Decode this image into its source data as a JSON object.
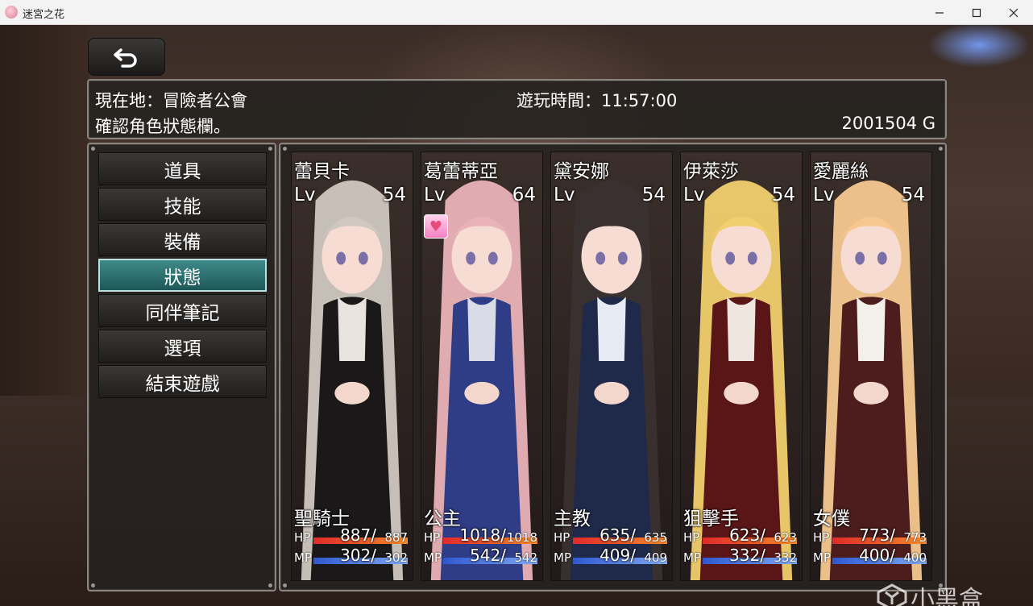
{
  "window": {
    "title": "迷宮之花",
    "minimize_icon": "minimize-icon",
    "maximize_icon": "maximize-icon",
    "close_icon": "close-icon"
  },
  "back_button": {
    "icon": "return-arrow-icon"
  },
  "info": {
    "location": "現在地：冒險者公會",
    "playtime": "遊玩時間：11:57:00",
    "hint": "確認角色狀態欄。",
    "gold": "2001504 G"
  },
  "menu": {
    "items": [
      {
        "label": "道具"
      },
      {
        "label": "技能"
      },
      {
        "label": "裝備"
      },
      {
        "label": "狀態",
        "active": true
      },
      {
        "label": "同伴筆記"
      },
      {
        "label": "選項"
      },
      {
        "label": "結束遊戲"
      }
    ]
  },
  "party": [
    {
      "name": "蕾貝卡",
      "lv_label": "Lv",
      "lv": "54",
      "class": "聖騎士",
      "hp_label": "HP",
      "hp": "887/",
      "hp_max": "887",
      "mp_label": "MP",
      "mp": "302/",
      "mp_max": "302",
      "hair": "#cfc7c0",
      "outfit": "#1a1818",
      "accent": "#e8e3de"
    },
    {
      "name": "葛蕾蒂亞",
      "lv_label": "Lv",
      "lv": "64",
      "class": "公主",
      "hp_label": "HP",
      "hp": "1018/",
      "hp_max": "1018",
      "mp_label": "MP",
      "mp": "542/",
      "mp_max": "542",
      "state_icon": "heart-state-icon",
      "hair": "#eab3b8",
      "outfit": "#2f3c86",
      "accent": "#d9dbe6"
    },
    {
      "name": "黛安娜",
      "lv_label": "Lv",
      "lv": "54",
      "class": "主教",
      "hp_label": "HP",
      "hp": "635/",
      "hp_max": "635",
      "mp_label": "MP",
      "mp": "409/",
      "mp_max": "409",
      "hair": "#3a3030",
      "outfit": "#1f2a4a",
      "accent": "#e6ebf3"
    },
    {
      "name": "伊萊莎",
      "lv_label": "Lv",
      "lv": "54",
      "class": "狙擊手",
      "hp_label": "HP",
      "hp": "623/",
      "hp_max": "623",
      "mp_label": "MP",
      "mp": "332/",
      "mp_max": "332",
      "hair": "#f1cf6e",
      "outfit": "#5a1616",
      "accent": "#f0e6e0"
    },
    {
      "name": "愛麗絲",
      "lv_label": "Lv",
      "lv": "54",
      "class": "女僕",
      "hp_label": "HP",
      "hp": "773/",
      "hp_max": "773",
      "mp_label": "MP",
      "mp": "400/",
      "mp_max": "400",
      "hair": "#f6c890",
      "outfit": "#4d1c1c",
      "accent": "#f3efe9"
    }
  ],
  "watermark": {
    "text": "小黑盒",
    "icon": "xiaoheihe-logo-icon"
  }
}
